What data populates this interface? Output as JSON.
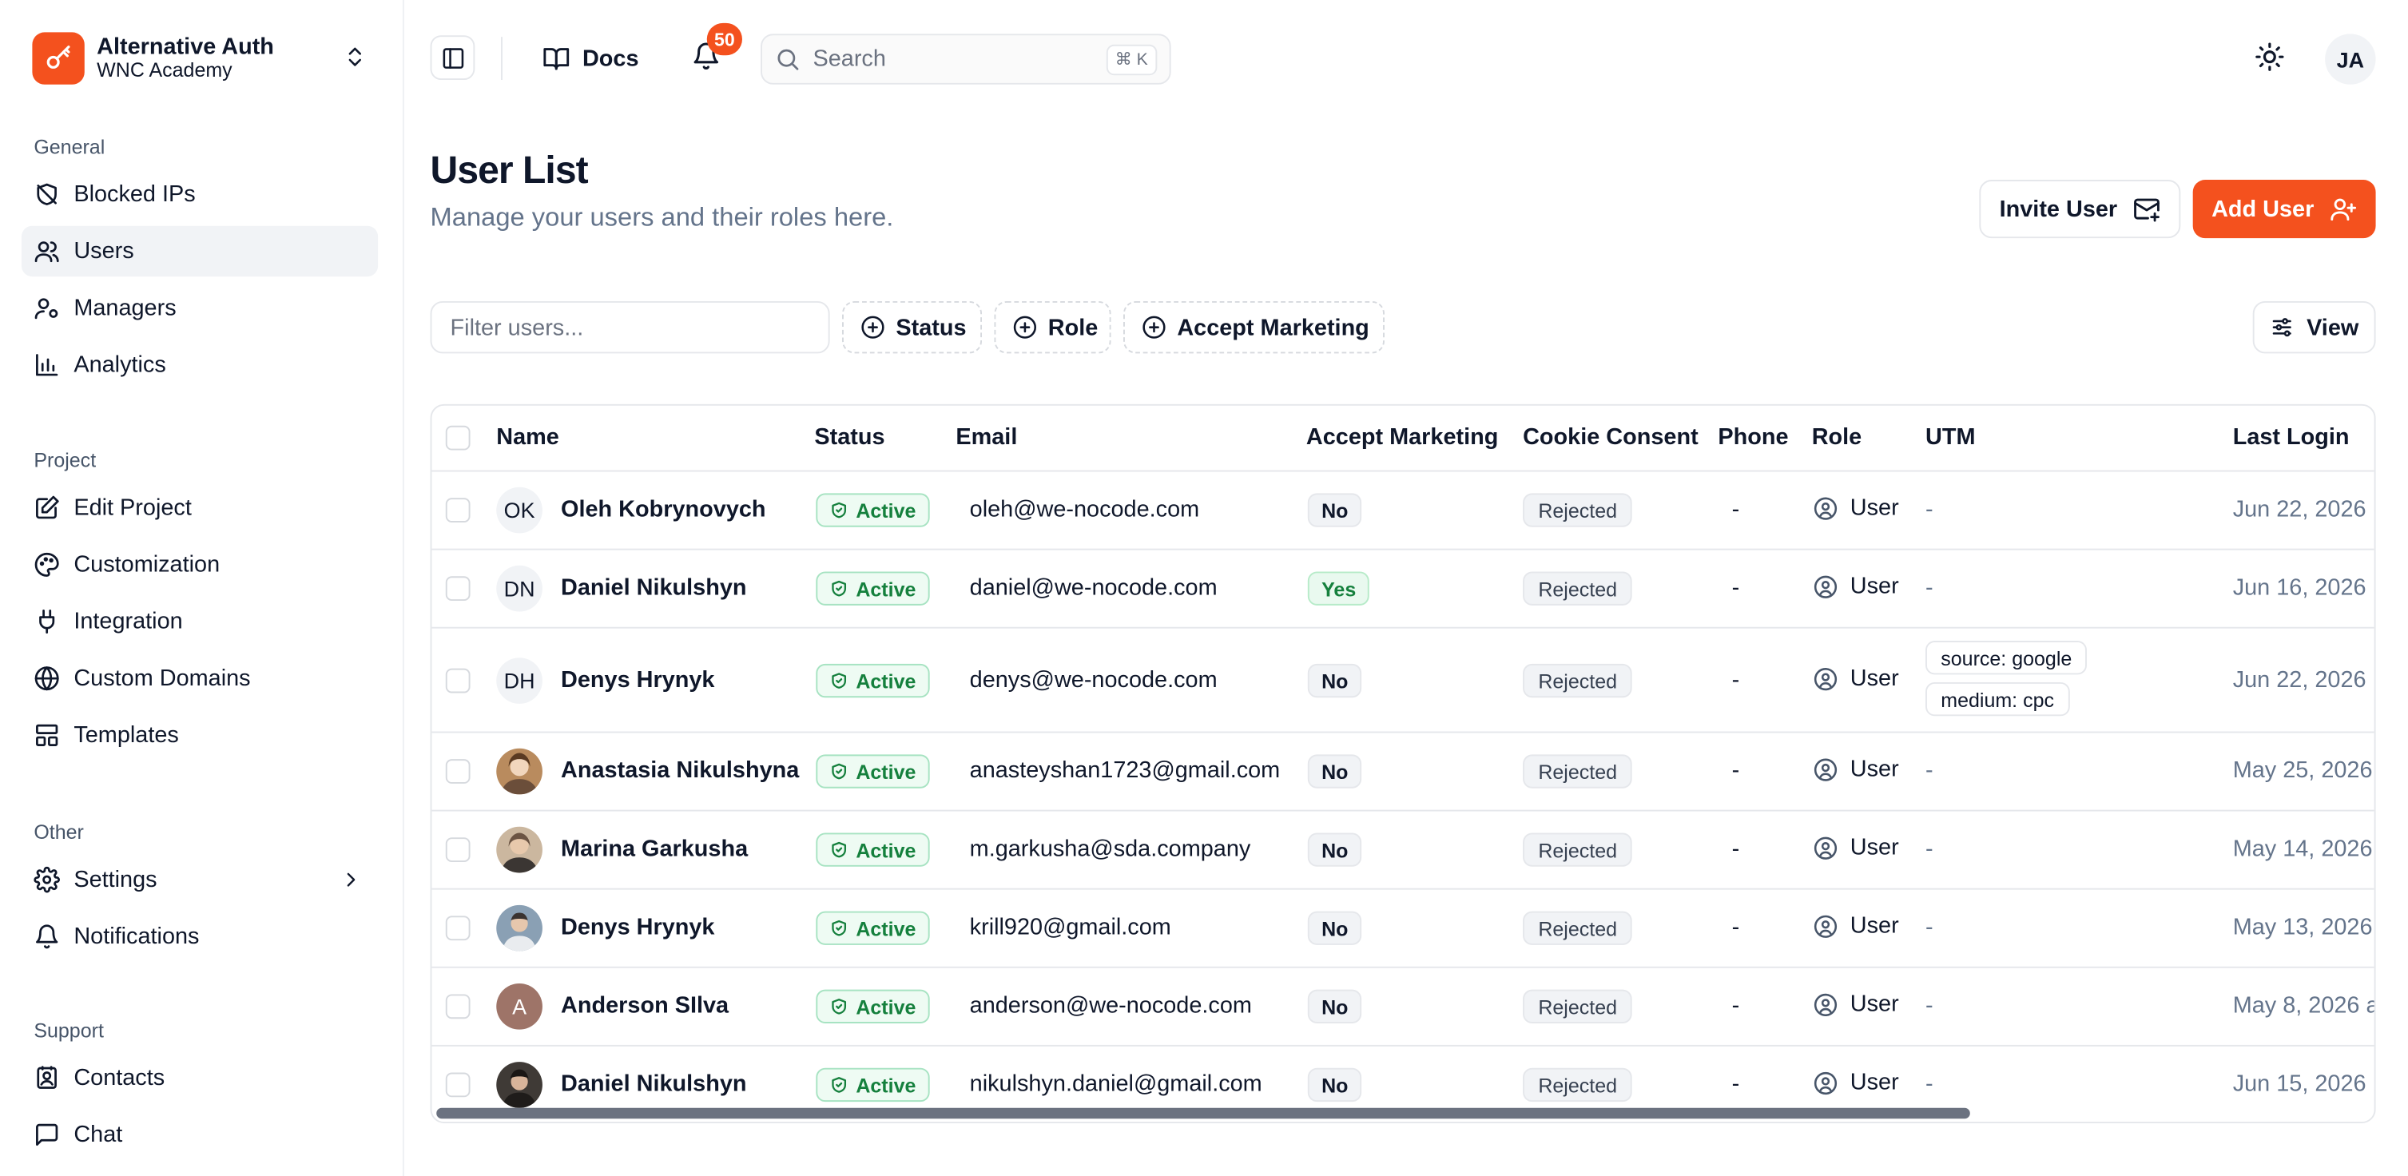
{
  "brand": {
    "title": "Alternative Auth",
    "subtitle": "WNC Academy",
    "color": "#f4511e",
    "icon": "key-icon"
  },
  "sidebar": {
    "groups": [
      {
        "heading": "General",
        "items": [
          {
            "label": "Blocked IPs",
            "icon": "shield-off-icon"
          },
          {
            "label": "Users",
            "icon": "users-icon",
            "active": true
          },
          {
            "label": "Managers",
            "icon": "user-cog-icon"
          },
          {
            "label": "Analytics",
            "icon": "bar-chart-icon"
          }
        ]
      },
      {
        "heading": "Project",
        "items": [
          {
            "label": "Edit Project",
            "icon": "edit-icon"
          },
          {
            "label": "Customization",
            "icon": "palette-icon"
          },
          {
            "label": "Integration",
            "icon": "plug-icon"
          },
          {
            "label": "Custom Domains",
            "icon": "globe-icon"
          },
          {
            "label": "Templates",
            "icon": "layout-icon"
          }
        ]
      },
      {
        "heading": "Other",
        "items": [
          {
            "label": "Settings",
            "icon": "gear-icon"
          },
          {
            "label": "Notifications",
            "icon": "bell-icon"
          }
        ]
      },
      {
        "heading": "Support",
        "items": [
          {
            "label": "Contacts",
            "icon": "contacts-icon"
          },
          {
            "label": "Chat",
            "icon": "chat-icon"
          }
        ]
      }
    ]
  },
  "topbar": {
    "docs_label": "Docs",
    "notification_count": "50",
    "search_placeholder": "Search",
    "search_shortcut": "⌘ K",
    "user_initials": "JA"
  },
  "page": {
    "title": "User List",
    "subtitle": "Manage your users and their roles here.",
    "invite_label": "Invite User",
    "add_label": "Add User"
  },
  "filters": {
    "placeholder": "Filter users...",
    "chips": [
      "Status",
      "Role",
      "Accept Marketing"
    ],
    "view_label": "View"
  },
  "table": {
    "columns": [
      "Name",
      "Status",
      "Email",
      "Accept Marketing",
      "Cookie Consent",
      "Phone",
      "Role",
      "UTM",
      "Last Login"
    ],
    "rows": [
      {
        "avatar": "OK",
        "avatar_type": "initials",
        "name": "Oleh Kobrynovych",
        "status": "Active",
        "email": "oleh@we-nocode.com",
        "marketing": "No",
        "cookie": "Rejected",
        "phone": "-",
        "role": "User",
        "utm": "-",
        "last_login": "Jun 22, 2026"
      },
      {
        "avatar": "DN",
        "avatar_type": "initials",
        "name": "Daniel Nikulshyn",
        "status": "Active",
        "email": "daniel@we-nocode.com",
        "marketing": "Yes",
        "cookie": "Rejected",
        "phone": "-",
        "role": "User",
        "utm": "-",
        "last_login": "Jun 16, 2026"
      },
      {
        "avatar": "DH",
        "avatar_type": "initials",
        "name": "Denys Hrynyk",
        "status": "Active",
        "email": "denys@we-nocode.com",
        "marketing": "No",
        "cookie": "Rejected",
        "phone": "-",
        "role": "User",
        "utm_tags": [
          "source: google",
          "medium: cpc"
        ],
        "last_login": "Jun 22, 2026"
      },
      {
        "avatar": "",
        "avatar_type": "photo",
        "photo_color": "#b98b5e",
        "name": "Anastasia Nikulshyna",
        "status": "Active",
        "email": "anasteyshan1723@gmail.com",
        "marketing": "No",
        "cookie": "Rejected",
        "phone": "-",
        "role": "User",
        "utm": "-",
        "last_login": "May 25, 2026"
      },
      {
        "avatar": "",
        "avatar_type": "photo",
        "photo_color": "#7a6a5c",
        "name": "Marina Garkusha",
        "status": "Active",
        "email": "m.garkusha@sda.company",
        "marketing": "No",
        "cookie": "Rejected",
        "phone": "-",
        "role": "User",
        "utm": "-",
        "last_login": "May 14, 2026"
      },
      {
        "avatar": "",
        "avatar_type": "photo",
        "photo_color": "#8aa0b4",
        "name": "Denys Hrynyk",
        "status": "Active",
        "email": "krill920@gmail.com",
        "marketing": "No",
        "cookie": "Rejected",
        "phone": "-",
        "role": "User",
        "utm": "-",
        "last_login": "May 13, 2026"
      },
      {
        "avatar": "A",
        "avatar_type": "letter",
        "photo_color": "#9e7468",
        "name": "Anderson SIlva",
        "status": "Active",
        "email": "anderson@we-nocode.com",
        "marketing": "No",
        "cookie": "Rejected",
        "phone": "-",
        "role": "User",
        "utm": "-",
        "last_login": "May 8, 2026 a"
      },
      {
        "avatar": "",
        "avatar_type": "photo",
        "photo_color": "#3f3a36",
        "name": "Daniel Nikulshyn",
        "status": "Active",
        "email": "nikulshyn.daniel@gmail.com",
        "marketing": "No",
        "cookie": "Rejected",
        "phone": "-",
        "role": "User",
        "utm": "-",
        "last_login": "Jun 15, 2026"
      }
    ]
  },
  "colors": {
    "accent": "#f4511e",
    "active_green": "#15803d",
    "muted": "#64748b"
  }
}
